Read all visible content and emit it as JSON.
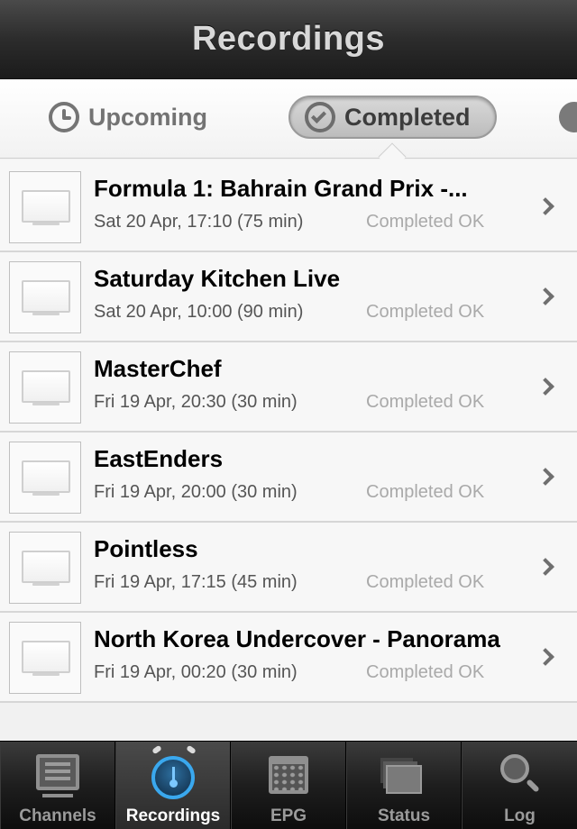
{
  "navbar": {
    "title": "Recordings"
  },
  "segments": {
    "upcoming": "Upcoming",
    "completed": "Completed",
    "selected": "Completed"
  },
  "recordings": [
    {
      "title": "Formula 1: Bahrain Grand Prix -...",
      "time": "Sat 20 Apr, 17:10 (75 min)",
      "status": "Completed OK"
    },
    {
      "title": "Saturday Kitchen Live",
      "time": "Sat 20 Apr, 10:00 (90 min)",
      "status": "Completed OK"
    },
    {
      "title": "MasterChef",
      "time": "Fri 19 Apr, 20:30 (30 min)",
      "status": "Completed OK"
    },
    {
      "title": "EastEnders",
      "time": "Fri 19 Apr, 20:00 (30 min)",
      "status": "Completed OK"
    },
    {
      "title": "Pointless",
      "time": "Fri 19 Apr, 17:15 (45 min)",
      "status": "Completed OK"
    },
    {
      "title": "North Korea Undercover - Panorama",
      "time": "Fri 19 Apr, 00:20 (30 min)",
      "status": "Completed OK"
    }
  ],
  "tabbar": {
    "items": [
      {
        "label": "Channels",
        "icon": "channels-icon"
      },
      {
        "label": "Recordings",
        "icon": "recordings-icon"
      },
      {
        "label": "EPG",
        "icon": "epg-icon"
      },
      {
        "label": "Status",
        "icon": "status-icon"
      },
      {
        "label": "Log",
        "icon": "log-icon"
      }
    ],
    "active": "Recordings"
  },
  "colors": {
    "accent": "#3aa8ee",
    "status_text": "#a9a9a9",
    "navbar_title": "#d8d8d8"
  }
}
